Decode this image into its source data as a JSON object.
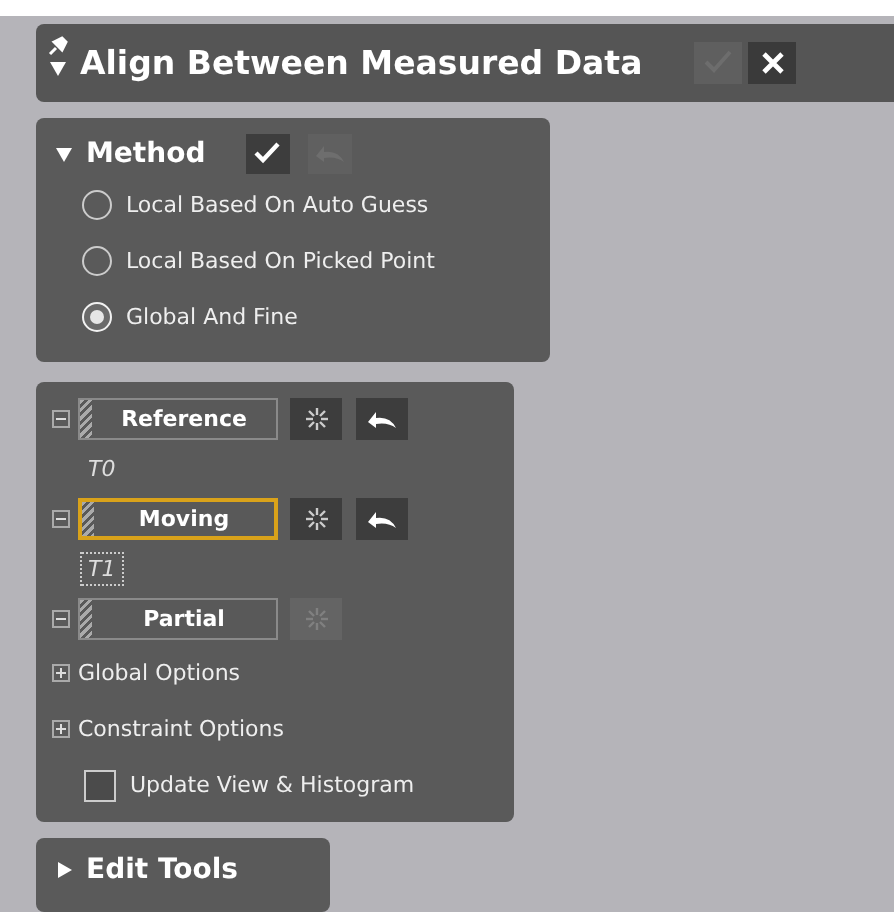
{
  "window": {
    "title": "Align Between Measured Data",
    "expanded": true,
    "ok_disabled": true
  },
  "method": {
    "label": "Method",
    "expanded": true,
    "apply_disabled": false,
    "undo_disabled": true,
    "options": [
      {
        "label": "Local Based On Auto Guess",
        "selected": false
      },
      {
        "label": "Local Based On Picked Point",
        "selected": false
      },
      {
        "label": "Global And Fine",
        "selected": true
      }
    ]
  },
  "elements": [
    {
      "label": "Reference",
      "selected": false,
      "expanded": true,
      "freeze_disabled": false,
      "undo": true,
      "child": "T0",
      "child_focused": false
    },
    {
      "label": "Moving",
      "selected": true,
      "expanded": true,
      "freeze_disabled": false,
      "undo": true,
      "child": "T1",
      "child_focused": true
    },
    {
      "label": "Partial",
      "selected": false,
      "expanded": true,
      "freeze_disabled": true,
      "undo": false
    }
  ],
  "option_groups": [
    {
      "label": "Global Options",
      "expanded": false
    },
    {
      "label": "Constraint Options",
      "expanded": false
    }
  ],
  "update_view": {
    "label": "Update View & Histogram",
    "checked": false
  },
  "edit_tools": {
    "label": "Edit Tools",
    "expanded": false
  }
}
